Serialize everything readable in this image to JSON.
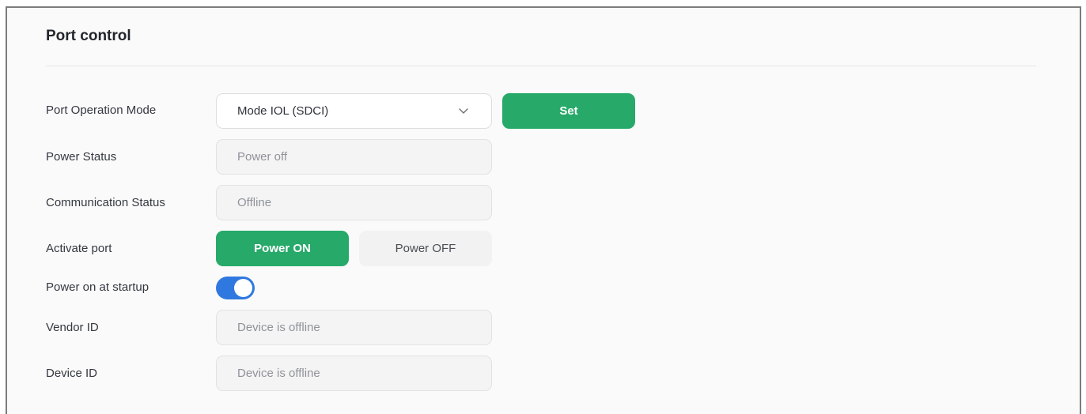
{
  "section": {
    "title": "Port control"
  },
  "port_operation_mode": {
    "label": "Port Operation Mode",
    "selected": "Mode IOL (SDCI)",
    "set_label": "Set"
  },
  "power_status": {
    "label": "Power Status",
    "placeholder": "Power off"
  },
  "communication_status": {
    "label": "Communication Status",
    "placeholder": "Offline"
  },
  "activate_port": {
    "label": "Activate port",
    "power_on_label": "Power ON",
    "power_off_label": "Power OFF"
  },
  "power_on_startup": {
    "label": "Power on at startup",
    "enabled": true
  },
  "vendor_id": {
    "label": "Vendor ID",
    "placeholder": "Device is offline"
  },
  "device_id": {
    "label": "Device ID",
    "placeholder": "Device is offline"
  },
  "colors": {
    "accent_green": "#27a96a",
    "toggle_blue": "#2f78e0"
  },
  "icons": {
    "select_arrow": "chevron-down-icon"
  }
}
